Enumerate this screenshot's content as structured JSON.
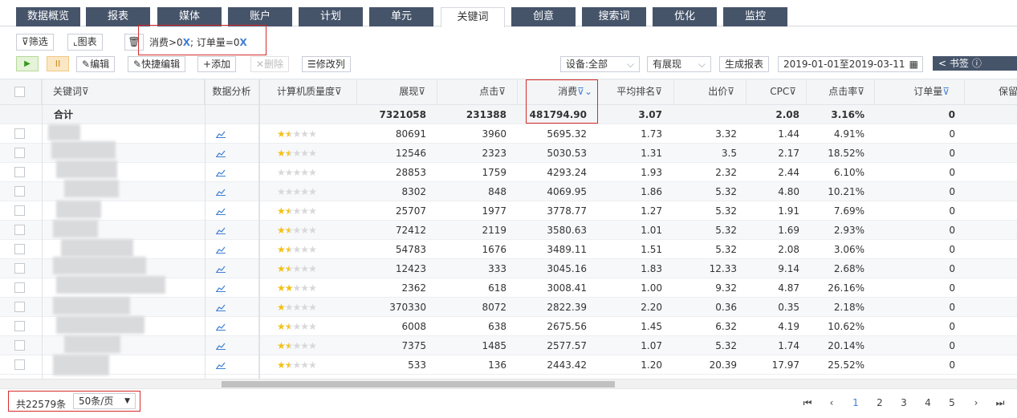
{
  "tabs": [
    "数据概览",
    "报表",
    "媒体",
    "账户",
    "计划",
    "单元",
    "关键词",
    "创意",
    "搜索词",
    "优化",
    "监控"
  ],
  "active_tab": "关键词",
  "toolbar1": {
    "filter_label": "筛选",
    "chart_label": "图表",
    "filter_condition": "消费>0",
    "filter_sep": "; ",
    "filter_condition2": "订单量=0",
    "remove": "X"
  },
  "toolbar2": {
    "play": "▶",
    "pause": "II",
    "edit": "编辑",
    "quick_edit": "快捷编辑",
    "add": "添加",
    "delete": "删除",
    "modify_cols": "修改列",
    "device": "设备:全部",
    "display": "有展现",
    "gen_report": "生成报表",
    "date_range": "2019-01-01至2019-03-11",
    "bookmark": "< 书签"
  },
  "columns": [
    "关键词",
    "数据分析",
    "计算机质量度",
    "展现",
    "点击",
    "消费",
    "平均排名",
    "出价",
    "CPC",
    "点击率",
    "订单量",
    "保留"
  ],
  "total": {
    "label": "合计",
    "impressions": "7321058",
    "clicks": "231388",
    "cost": "481794.90",
    "avg_rank": "3.07",
    "bid": "",
    "cpc": "2.08",
    "ctr": "3.16%",
    "orders": "0"
  },
  "rows": [
    {
      "stars": 1.5,
      "impressions": "80691",
      "clicks": "3960",
      "cost": "5695.32",
      "avg_rank": "1.73",
      "bid": "3.32",
      "cpc": "1.44",
      "ctr": "4.91%",
      "orders": "0"
    },
    {
      "stars": 1.5,
      "impressions": "12546",
      "clicks": "2323",
      "cost": "5030.53",
      "avg_rank": "1.31",
      "bid": "3.5",
      "cpc": "2.17",
      "ctr": "18.52%",
      "orders": "0"
    },
    {
      "stars": 0,
      "impressions": "28853",
      "clicks": "1759",
      "cost": "4293.24",
      "avg_rank": "1.93",
      "bid": "2.32",
      "cpc": "2.44",
      "ctr": "6.10%",
      "orders": "0"
    },
    {
      "stars": 0,
      "impressions": "8302",
      "clicks": "848",
      "cost": "4069.95",
      "avg_rank": "1.86",
      "bid": "5.32",
      "cpc": "4.80",
      "ctr": "10.21%",
      "orders": "0"
    },
    {
      "stars": 1.5,
      "impressions": "25707",
      "clicks": "1977",
      "cost": "3778.77",
      "avg_rank": "1.27",
      "bid": "5.32",
      "cpc": "1.91",
      "ctr": "7.69%",
      "orders": "0"
    },
    {
      "stars": 1.5,
      "impressions": "72412",
      "clicks": "2119",
      "cost": "3580.63",
      "avg_rank": "1.01",
      "bid": "5.32",
      "cpc": "1.69",
      "ctr": "2.93%",
      "orders": "0"
    },
    {
      "stars": 1.5,
      "impressions": "54783",
      "clicks": "1676",
      "cost": "3489.11",
      "avg_rank": "1.51",
      "bid": "5.32",
      "cpc": "2.08",
      "ctr": "3.06%",
      "orders": "0"
    },
    {
      "stars": 1.5,
      "impressions": "12423",
      "clicks": "333",
      "cost": "3045.16",
      "avg_rank": "1.83",
      "bid": "12.33",
      "cpc": "9.14",
      "ctr": "2.68%",
      "orders": "0"
    },
    {
      "stars": 2,
      "impressions": "2362",
      "clicks": "618",
      "cost": "3008.41",
      "avg_rank": "1.00",
      "bid": "9.32",
      "cpc": "4.87",
      "ctr": "26.16%",
      "orders": "0"
    },
    {
      "stars": 1,
      "impressions": "370330",
      "clicks": "8072",
      "cost": "2822.39",
      "avg_rank": "2.20",
      "bid": "0.36",
      "cpc": "0.35",
      "ctr": "2.18%",
      "orders": "0"
    },
    {
      "stars": 1.5,
      "impressions": "6008",
      "clicks": "638",
      "cost": "2675.56",
      "avg_rank": "1.45",
      "bid": "6.32",
      "cpc": "4.19",
      "ctr": "10.62%",
      "orders": "0"
    },
    {
      "stars": 1.5,
      "impressions": "7375",
      "clicks": "1485",
      "cost": "2577.57",
      "avg_rank": "1.07",
      "bid": "5.32",
      "cpc": "1.74",
      "ctr": "20.14%",
      "orders": "0"
    },
    {
      "stars": 1.5,
      "impressions": "533",
      "clicks": "136",
      "cost": "2443.42",
      "avg_rank": "1.20",
      "bid": "20.39",
      "cpc": "17.97",
      "ctr": "25.52%",
      "orders": "0"
    }
  ],
  "footer": {
    "total_count": "共22579条",
    "page_size": "50条/页",
    "pages": [
      "1",
      "2",
      "3",
      "4",
      "5"
    ],
    "current_page": "1"
  },
  "colors": {
    "tab_bg": "#46546a",
    "accent": "#3f7fd3",
    "highlight": "#d62b2b",
    "star": "#f3c014",
    "star_empty": "#d8d8d8"
  }
}
